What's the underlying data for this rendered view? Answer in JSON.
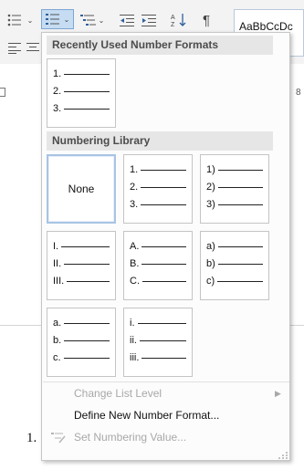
{
  "ribbon": {
    "style_sample": "AaBbCcDc",
    "ruler_number": "8",
    "icons": [
      "bullets-icon",
      "numbering-icon",
      "multilevel-list-icon",
      "decrease-indent-icon",
      "increase-indent-icon",
      "sort-icon",
      "pilcrow-icon",
      "align-left-icon",
      "align-center-icon"
    ]
  },
  "dropdown": {
    "recent_header": "Recently Used Number Formats",
    "library_header": "Numbering Library",
    "recent_formats": [
      {
        "items": [
          "1.",
          "2.",
          "3."
        ]
      }
    ],
    "library": {
      "none_label": "None",
      "formats": [
        {
          "items": [
            "1.",
            "2.",
            "3."
          ]
        },
        {
          "items": [
            "1)",
            "2)",
            "3)"
          ]
        },
        {
          "items": [
            "I.",
            "II.",
            "III."
          ]
        },
        {
          "items": [
            "A.",
            "B.",
            "C."
          ]
        },
        {
          "items": [
            "a)",
            "b)",
            "c)"
          ]
        },
        {
          "items": [
            "a.",
            "b.",
            "c."
          ]
        },
        {
          "items": [
            "i.",
            "ii.",
            "iii."
          ]
        }
      ]
    },
    "selected_tile": "none",
    "menu": {
      "change_level": "Change List Level",
      "define_new": "Define New Number Format...",
      "set_value": "Set Numbering Value..."
    }
  },
  "document": {
    "list_number": "1."
  },
  "colors": {
    "selected_border": "#a9c4e4",
    "pressed_button": "#c5dcf2",
    "section_header_bg": "#e6e6e6",
    "disabled_text": "#a8a8a8"
  }
}
